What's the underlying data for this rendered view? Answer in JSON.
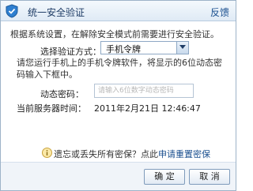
{
  "dialog": {
    "title": "统一安全验证",
    "feedback_link": "反馈"
  },
  "content": {
    "intro": "根据系统设置，在解除安全模式前需要进行安全验证。",
    "method_label": "选择验证方式：",
    "method_selected": "手机令牌",
    "instruction": "请您运行手机上的手机令牌软件，将显示的6位动态密码输入下框中。",
    "code_label": "动态密码：",
    "code_placeholder": "请输入6位数字动态密码",
    "time_label": "当前服务器时间：",
    "time_value": "2011年2月21日 12:46:47"
  },
  "help": {
    "text": "遗忘或丢失所有密保？点此",
    "link": "申请重置密保"
  },
  "buttons": {
    "ok": "确 定",
    "cancel": "取 消"
  },
  "colors": {
    "accent": "#1a4f8f",
    "border": "#9db3c8"
  }
}
